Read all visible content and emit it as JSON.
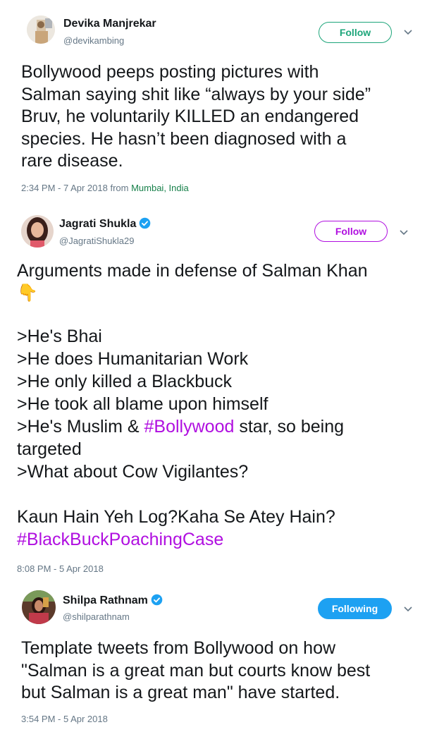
{
  "tweets": [
    {
      "name": "Devika Manjrekar",
      "handle": "@devikambing",
      "button": "Follow",
      "body_lines": [
        "Bollywood peeps posting pictures with",
        "Salman saying shit like “always by your side”",
        "Bruv, he voluntarily KILLED an endangered",
        "species. He hasn’t been diagnosed with a",
        "rare disease."
      ],
      "timestamp": "2:34 PM - 7 Apr 2018 from ",
      "location": "Mumbai, India"
    },
    {
      "name": "Jagrati Shukla",
      "handle": "@JagratiShukla29",
      "verified": true,
      "button": "Follow",
      "body_intro": "Arguments made in defense of Salman Khan",
      "emoji": "👇",
      "body_lines": [
        ">He's Bhai",
        ">He does Humanitarian Work",
        ">He only killed a Blackbuck",
        ">He took all blame upon himself"
      ],
      "line5_prefix": ">He's Muslim & ",
      "line5_hashtag": "#Bollywood",
      "line5_suffix": " star, so being",
      "line6": "targeted",
      "line7": ">What about Cow Vigilantes?",
      "closing": "Kaun Hain Yeh Log?Kaha Se Atey Hain?",
      "hashtag": "#BlackBuckPoachingCase",
      "timestamp": "8:08 PM - 5 Apr 2018"
    },
    {
      "name": "Shilpa Rathnam",
      "handle": "@shilparathnam",
      "verified": true,
      "button": "Following",
      "body_lines": [
        "Template tweets from Bollywood on how",
        "\"Salman is a great man but courts know best",
        "but Salman is a great man\" have started."
      ],
      "timestamp": "3:54 PM - 5 Apr 2018"
    }
  ],
  "colors": {
    "follow_border_1": "#1da57a",
    "follow_text_1": "#1da57a",
    "follow_border_2": "#b00fe0",
    "follow_text_2": "#b00fe0",
    "following_bg": "#1da1f2",
    "verified": "#1da1f2",
    "hashtag": "#b00fe0",
    "location": "#17804a"
  }
}
